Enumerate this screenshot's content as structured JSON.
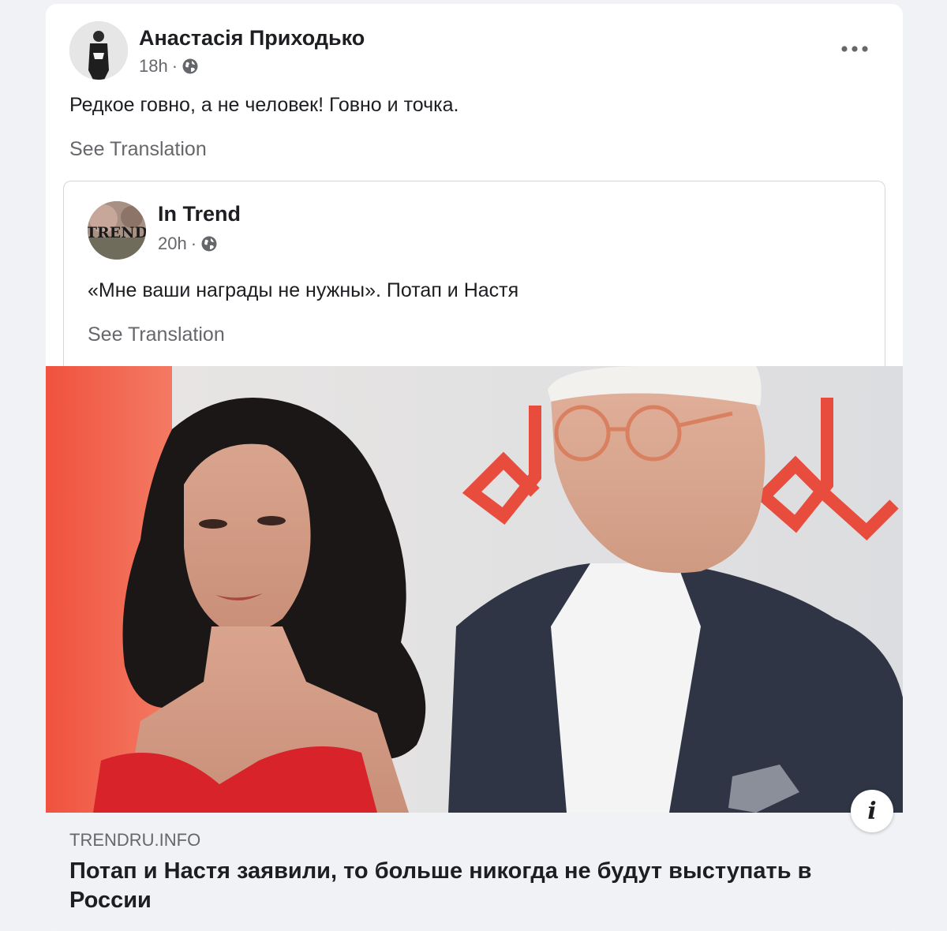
{
  "post": {
    "author": "Анастасія Приходько",
    "time": "18h",
    "separator": "·",
    "text": "Редкое говно, а не человек! Говно и точка.",
    "see_translation": "See Translation",
    "more_icon": "more-horizontal-icon",
    "privacy_icon": "globe-icon"
  },
  "shared_post": {
    "author": "In Trend",
    "avatar_text": "TREND",
    "time": "20h",
    "separator": "·",
    "text": "«Мне ваши награды не нужны». Потап и Настя",
    "see_translation": "See Translation",
    "privacy_icon": "globe-icon"
  },
  "link_preview": {
    "domain": "TRENDRU.INFO",
    "title": "Потап и Настя заявили, то больше никогда не будут выступать в России",
    "info_label": "i",
    "info_icon": "info-icon"
  },
  "colors": {
    "background": "#f0f2f5",
    "card": "#ffffff",
    "primary_text": "#1c1e21",
    "secondary_text": "#65676b",
    "logo_red": "#e84c3d"
  }
}
